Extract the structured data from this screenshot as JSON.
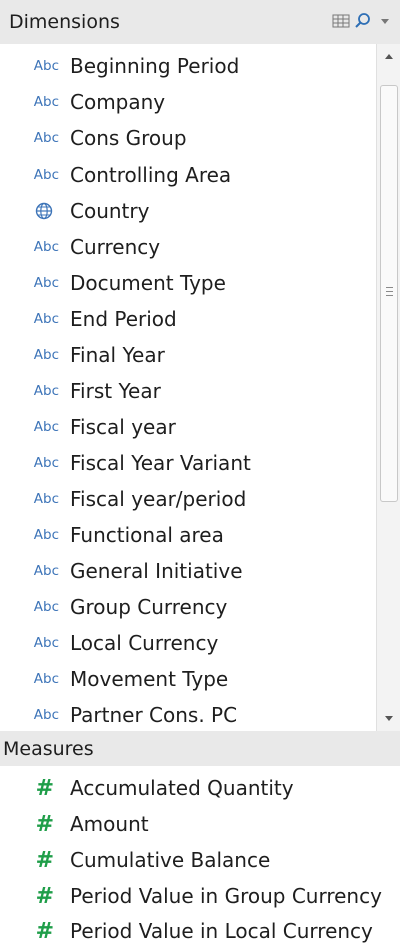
{
  "dimensions": {
    "title": "Dimensions",
    "icons": [
      "list-view-icon",
      "search-icon",
      "dropdown-arrow-icon"
    ],
    "items": [
      {
        "type": "Abc",
        "label": "Beginning Period"
      },
      {
        "type": "Abc",
        "label": "Company"
      },
      {
        "type": "Abc",
        "label": "Cons Group"
      },
      {
        "type": "Abc",
        "label": "Controlling Area"
      },
      {
        "type": "globe-icon",
        "label": "Country"
      },
      {
        "type": "Abc",
        "label": "Currency"
      },
      {
        "type": "Abc",
        "label": "Document Type"
      },
      {
        "type": "Abc",
        "label": "End Period"
      },
      {
        "type": "Abc",
        "label": "Final Year"
      },
      {
        "type": "Abc",
        "label": "First Year"
      },
      {
        "type": "Abc",
        "label": "Fiscal year"
      },
      {
        "type": "Abc",
        "label": "Fiscal Year Variant"
      },
      {
        "type": "Abc",
        "label": "Fiscal year/period"
      },
      {
        "type": "Abc",
        "label": "Functional area"
      },
      {
        "type": "Abc",
        "label": "General Initiative"
      },
      {
        "type": "Abc",
        "label": "Group Currency"
      },
      {
        "type": "Abc",
        "label": "Local Currency"
      },
      {
        "type": "Abc",
        "label": "Movement Type"
      },
      {
        "type": "Abc",
        "label": "Partner Cons. PC"
      }
    ]
  },
  "measures": {
    "title": "Measures",
    "items": [
      {
        "type": "#",
        "label": "Accumulated Quantity"
      },
      {
        "type": "#",
        "label": "Amount"
      },
      {
        "type": "#",
        "label": "Cumulative Balance"
      },
      {
        "type": "#",
        "label": "Period Value in Group Currency"
      },
      {
        "type": "#",
        "label": "Period Value in Local Currency"
      }
    ]
  },
  "colors": {
    "abc_text": "#3d74b8",
    "measure_hash": "#1f9e49",
    "header_bg": "#e9e9e9"
  }
}
